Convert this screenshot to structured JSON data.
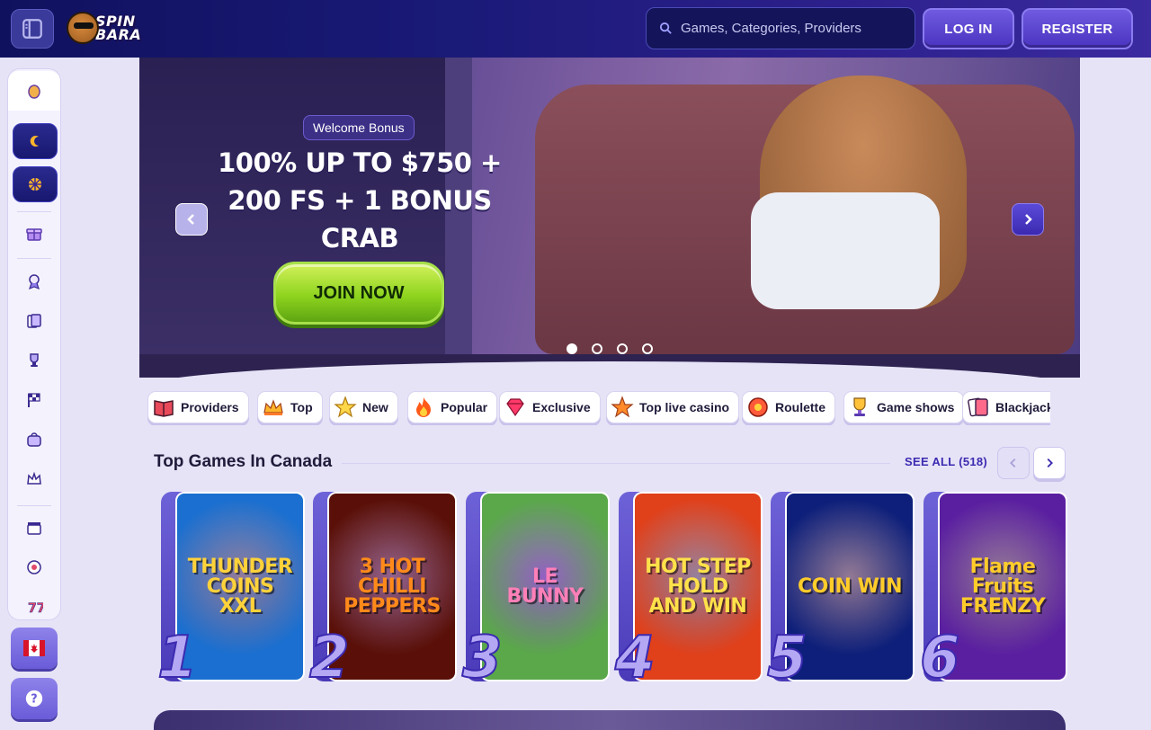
{
  "header": {
    "logo_line1": "SPIN",
    "logo_line2": "BARA",
    "search_placeholder": "Games, Categories, Providers",
    "login_label": "LOG IN",
    "register_label": "REGISTER"
  },
  "hero": {
    "badge": "Welcome Bonus",
    "title_line1": "100% UP TO $750 +",
    "title_line2": "200 FS + 1 BONUS",
    "title_line3": "CRAB",
    "cta_label": "JOIN NOW",
    "slides": 4,
    "active_slide": 1
  },
  "categories": [
    {
      "label": "Providers",
      "icon": "book-icon"
    },
    {
      "label": "Top",
      "icon": "crown-icon"
    },
    {
      "label": "New",
      "icon": "star-new-icon"
    },
    {
      "label": "Popular",
      "icon": "fire-icon"
    },
    {
      "label": "Exclusive",
      "icon": "gem-icon"
    },
    {
      "label": "Top live casino",
      "icon": "star-icon"
    },
    {
      "label": "Roulette",
      "icon": "roulette-icon"
    },
    {
      "label": "Game shows",
      "icon": "trophy-icon"
    },
    {
      "label": "Blackjack",
      "icon": "cards-icon"
    }
  ],
  "section": {
    "title": "Top Games In Canada",
    "see_all": "SEE ALL (518)"
  },
  "games": [
    {
      "rank": "1",
      "title": "THUNDER COINS XXL",
      "bg": "#1a6fd0",
      "fg": "#ffd23a"
    },
    {
      "rank": "2",
      "title": "3 HOT CHILLI PEPPERS",
      "bg": "#5a1008",
      "fg": "#ff8a1a"
    },
    {
      "rank": "3",
      "title": "LE BUNNY",
      "bg": "#5aa84a",
      "fg": "#ff7fb8"
    },
    {
      "rank": "4",
      "title": "HOT STEP HOLD AND WIN",
      "bg": "#e0401a",
      "fg": "#ffe14a"
    },
    {
      "rank": "5",
      "title": "COIN WIN",
      "bg": "#0d1f7a",
      "fg": "#ffcc2a"
    },
    {
      "rank": "6",
      "title": "Flame Fruits FRENZY",
      "bg": "#5a1fa0",
      "fg": "#ffcc2a"
    }
  ],
  "colors": {
    "accent": "#3b2ab0",
    "header_bg": "#10115e",
    "cta_green": "#8ed41e"
  }
}
